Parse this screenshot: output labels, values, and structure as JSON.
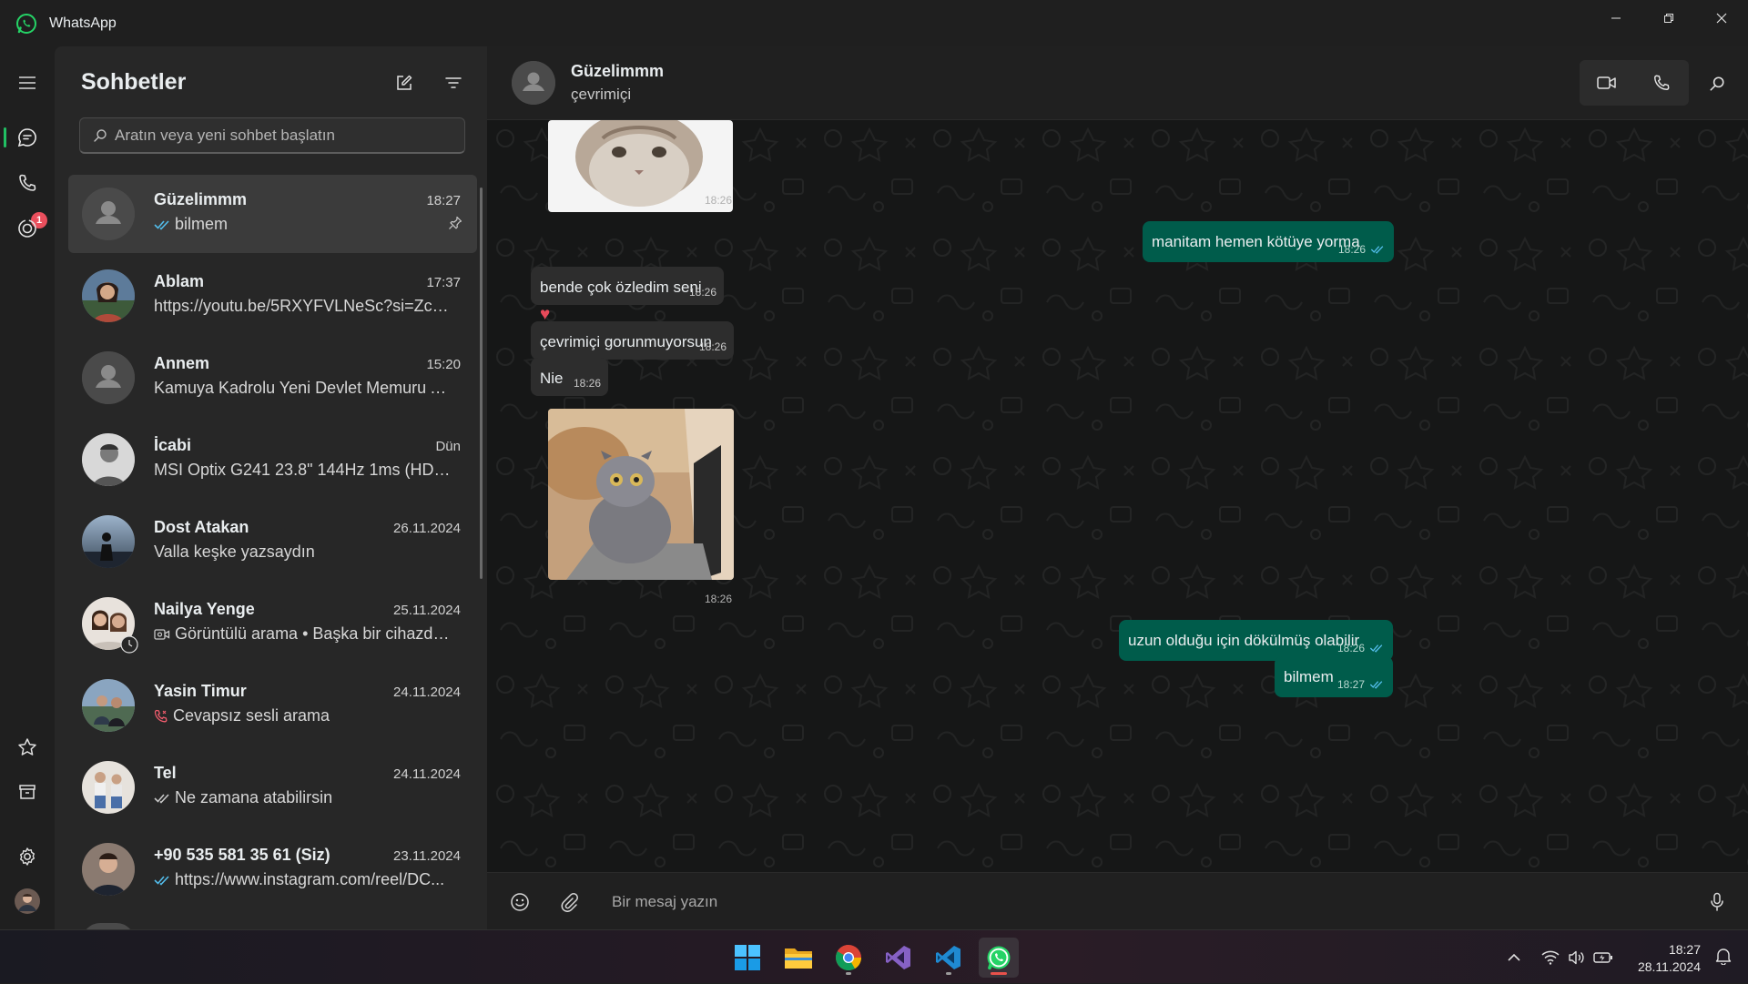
{
  "app": {
    "title": "WhatsApp"
  },
  "window_controls": [
    "minimize-icon",
    "restore-icon",
    "close-icon"
  ],
  "rail": {
    "items": [
      "menu-icon",
      "chats-icon",
      "calls-icon",
      "status-icon"
    ],
    "calls_badge": "1",
    "bottom_items": [
      "starred-icon",
      "archive-icon",
      "settings-icon",
      "profile-avatar"
    ]
  },
  "chatlist": {
    "title": "Sohbetler",
    "search_placeholder": "Aratın veya yeni sohbet başlatın",
    "chats": [
      {
        "name": "Güzelimmm",
        "time": "18:27",
        "message": "bilmem",
        "icon": "double-check-icon",
        "pinned": true,
        "selected": true
      },
      {
        "name": "Ablam",
        "time": "17:37",
        "message": "https://youtu.be/5RXYFVLNeSc?si=Zcq..."
      },
      {
        "name": "Annem",
        "time": "15:20",
        "message": "Kamuya Kadrolu Yeni Devlet Memuru A..."
      },
      {
        "name": "İcabi",
        "time": "Dün",
        "message": "MSI Optix G241 23.8\" 144Hz 1ms (HDM..."
      },
      {
        "name": "Dost Atakan",
        "time": "26.11.2024",
        "message": "Valla keşke yazsaydın"
      },
      {
        "name": "Nailya Yenge",
        "time": "25.11.2024",
        "message": "Görüntülü arama • Başka bir cihazda...",
        "icon": "video-call-icon"
      },
      {
        "name": "Yasin Timur",
        "time": "24.11.2024",
        "message": "Cevapsız sesli arama",
        "icon": "missed-call-icon"
      },
      {
        "name": "Tel",
        "time": "24.11.2024",
        "message": "Ne zamana atabilirsin",
        "icon": "double-check-icon"
      },
      {
        "name": "+90 535 581 35 61 (Siz)",
        "time": "23.11.2024",
        "message": "https://www.instagram.com/reel/DC...",
        "icon": "double-check-icon"
      }
    ]
  },
  "conversation": {
    "contact_name": "Güzelimmm",
    "contact_status": "çevrimiçi",
    "messages": [
      {
        "type": "image",
        "dir": "in",
        "time": "18:26",
        "image": "cat-closeup"
      },
      {
        "type": "text",
        "dir": "out",
        "text": "manitam hemen kötüye yorma",
        "time": "18:26"
      },
      {
        "type": "text",
        "dir": "in",
        "text": "bende çok özledim seni",
        "time": "18:26",
        "reaction": "❤️"
      },
      {
        "type": "text",
        "dir": "in",
        "text": "çevrimiçi gorunmuyorsun",
        "time": "18:26"
      },
      {
        "type": "text",
        "dir": "in",
        "text": "Nie",
        "time": "18:26"
      },
      {
        "type": "image",
        "dir": "in",
        "time": "18:26",
        "image": "cat-with-laptop"
      },
      {
        "type": "text",
        "dir": "out",
        "text": "uzun olduğu için dökülmüş olabilir",
        "time": "18:26"
      },
      {
        "type": "text",
        "dir": "out",
        "text": "bilmem",
        "time": "18:27"
      }
    ],
    "composer_placeholder": "Bir mesaj yazın"
  },
  "taskbar": {
    "apps": [
      "windows-start-icon",
      "file-explorer-icon",
      "chrome-icon",
      "visual-studio-icon",
      "vscode-icon",
      "whatsapp-icon"
    ],
    "active_app": "whatsapp-icon",
    "clock_time": "18:27",
    "clock_date": "28.11.2024"
  },
  "colors": {
    "accent": "#21c063",
    "outgoing_bubble": "#005c4b",
    "incoming_bubble": "#2d2d2d",
    "badge": "#ea4f5d"
  }
}
